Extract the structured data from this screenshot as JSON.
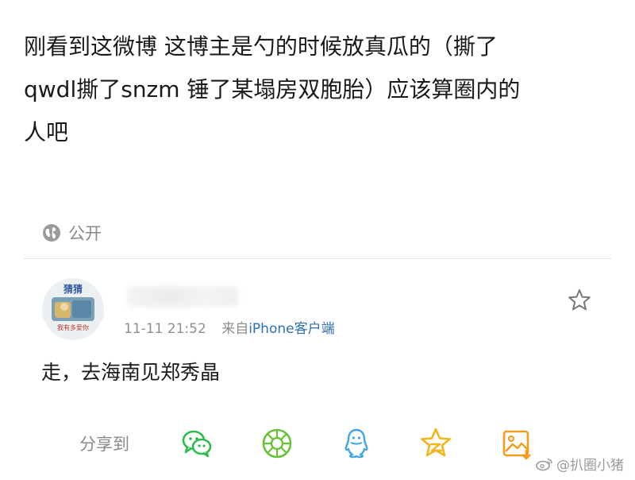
{
  "post": {
    "lines": [
      "刚看到这微博 这博主是勺的时候放真瓜的（撕了",
      "qwdl撕了snzm 锤了某塌房双胞胎）应该算圈内的",
      "人吧"
    ],
    "visibility": "公开"
  },
  "comment": {
    "avatar_label_top": "猜猜",
    "avatar_label_bottom": "我有多爱你",
    "time": "11-11 21:52",
    "source_prefix": "来自",
    "source_name": "iPhone客户端",
    "text": "走，去海南见郑秀晶"
  },
  "share": {
    "label": "分享到",
    "targets": [
      "wechat-icon",
      "moments-icon",
      "qq-icon",
      "qzone-icon",
      "album-icon"
    ]
  },
  "watermark": "@扒圈小猪",
  "colors": {
    "wechat": "#2dbb4d",
    "moments": "#67c23a",
    "qq": "#3fa6e8",
    "qzone": "#f5b417",
    "album": "#f39b1c",
    "link": "#2f6db5"
  }
}
